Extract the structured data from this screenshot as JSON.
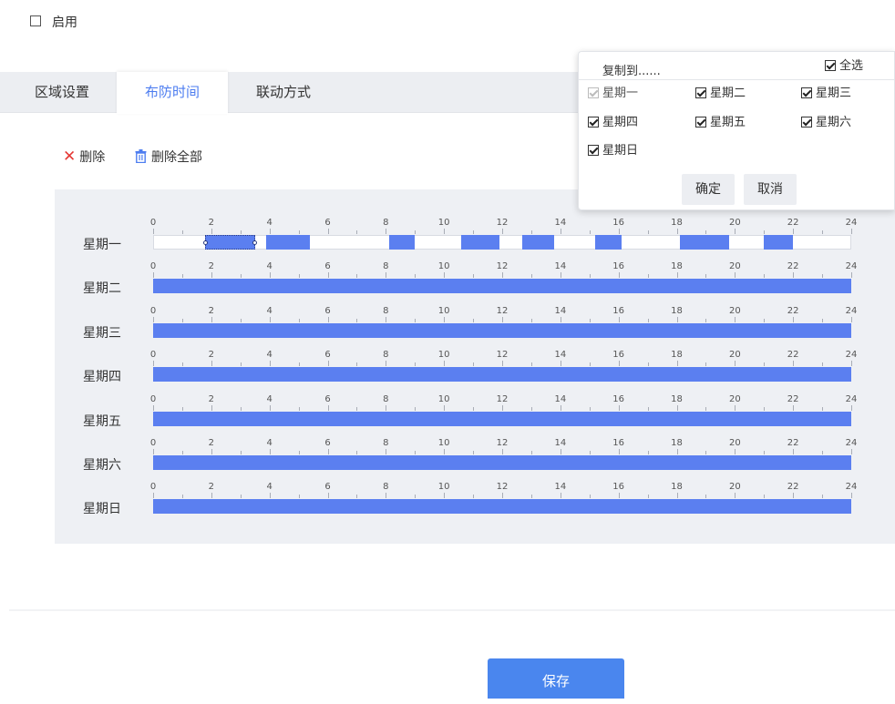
{
  "enable": {
    "label": "启用",
    "checked": false
  },
  "tabs": [
    {
      "label": "区域设置",
      "active": false
    },
    {
      "label": "布防时间",
      "active": true
    },
    {
      "label": "联动方式",
      "active": false
    }
  ],
  "actions": {
    "delete": "删除",
    "delete_all": "删除全部"
  },
  "schedule": {
    "hour_labels": [
      "0",
      "2",
      "4",
      "6",
      "8",
      "10",
      "12",
      "14",
      "16",
      "18",
      "20",
      "22",
      "24"
    ],
    "days": [
      {
        "label": "星期一",
        "full": false,
        "segments": [
          {
            "start": 1.8,
            "end": 3.5,
            "selected": true
          },
          {
            "start": 3.9,
            "end": 5.4
          },
          {
            "start": 8.1,
            "end": 9.0
          },
          {
            "start": 10.6,
            "end": 11.9
          },
          {
            "start": 12.7,
            "end": 13.8
          },
          {
            "start": 15.2,
            "end": 16.1
          },
          {
            "start": 18.1,
            "end": 19.8
          },
          {
            "start": 21.0,
            "end": 22.0
          }
        ]
      },
      {
        "label": "星期二",
        "full": true
      },
      {
        "label": "星期三",
        "full": true
      },
      {
        "label": "星期四",
        "full": true
      },
      {
        "label": "星期五",
        "full": true
      },
      {
        "label": "星期六",
        "full": true
      },
      {
        "label": "星期日",
        "full": true
      }
    ],
    "colors": {
      "segment": "#5b7ff0"
    }
  },
  "copy_popup": {
    "title": "复制到......",
    "select_all": {
      "label": "全选",
      "checked": true
    },
    "days": [
      {
        "label": "星期一",
        "checked": true,
        "disabled": true
      },
      {
        "label": "星期二",
        "checked": true
      },
      {
        "label": "星期三",
        "checked": true
      },
      {
        "label": "星期四",
        "checked": true
      },
      {
        "label": "星期五",
        "checked": true
      },
      {
        "label": "星期六",
        "checked": true
      },
      {
        "label": "星期日",
        "checked": true
      }
    ],
    "confirm": "确定",
    "cancel": "取消"
  },
  "save_label": "保存",
  "colors": {
    "accent": "#4d7df0",
    "save_button": "#4a86ee",
    "delete_icon": "#e53935"
  }
}
